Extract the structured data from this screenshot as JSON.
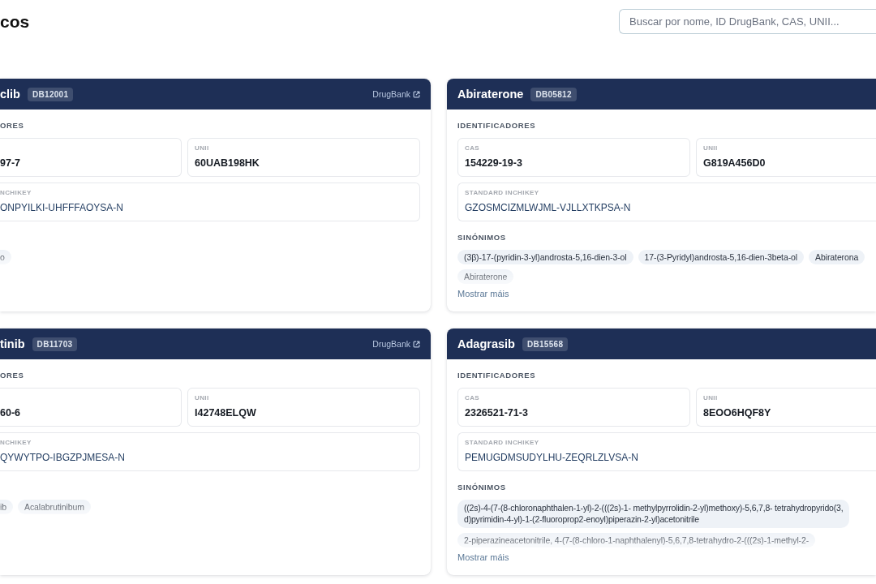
{
  "page": {
    "title": "cos"
  },
  "search": {
    "placeholder": "Buscar por nome, ID DrugBank, CAS, UNII..."
  },
  "cards": [
    {
      "name": "clib",
      "id": "DB12001",
      "link": "DrugBank",
      "identifiers_heading": "ORES",
      "fields": [
        {
          "kind": "id",
          "value": "97-7"
        },
        {
          "kind": "id",
          "label": "UNII",
          "value": "60UAB198HK"
        },
        {
          "kind": "inchikey",
          "label": "NCHIKEY",
          "value": "ONPYILKI-UHFFFAOYSA-N"
        }
      ],
      "synonyms": [
        "o"
      ]
    },
    {
      "name": "Abiraterone",
      "id": "DB05812",
      "identifiers_heading": "IDENTIFICADORES",
      "fields": [
        {
          "kind": "id",
          "label": "CAS",
          "value": "154229-19-3"
        },
        {
          "kind": "id",
          "label": "UNII",
          "value": "G819A456D0"
        },
        {
          "kind": "inchikey",
          "label": "STANDARD INCHIKEY",
          "value": "GZOSMCIZMLWJML-VJLLXTKPSA-N"
        }
      ],
      "synonyms_heading": "SINÓNIMOS",
      "synonyms": [
        "(3β)-17-(pyridin-3-yl)androsta-5,16-dien-3-ol",
        "17-(3-Pyridyl)androsta-5,16-dien-3beta-ol",
        "Abiraterona",
        "Abiraterone"
      ],
      "more": "Mostrar máis"
    },
    {
      "name": "tinib",
      "id": "DB11703",
      "link": "DrugBank",
      "identifiers_heading": "ORES",
      "fields": [
        {
          "kind": "id",
          "value": "60-6"
        },
        {
          "kind": "id",
          "label": "UNII",
          "value": "I42748ELQW"
        },
        {
          "kind": "inchikey",
          "label": "NCHIKEY",
          "value": "QYWYTPO-IBGZPJMESA-N"
        }
      ],
      "synonyms": [
        "ib",
        "Acalabrutinibum"
      ]
    },
    {
      "name": "Adagrasib",
      "id": "DB15568",
      "identifiers_heading": "IDENTIFICADORES",
      "fields": [
        {
          "kind": "id",
          "label": "CAS",
          "value": "2326521-71-3"
        },
        {
          "kind": "id",
          "label": "UNII",
          "value": "8EOO6HQF8Y"
        },
        {
          "kind": "inchikey",
          "label": "STANDARD INCHIKEY",
          "value": "PEMUGDMSUDYLHU-ZEQRLZLVSA-N"
        }
      ],
      "synonyms_heading": "SINÓNIMOS",
      "synonyms": [
        "((2s)-4-(7-(8-chloronaphthalen-1-yl)-2-(((2s)-1- methylpyrrolidin-2-yl)methoxy)-5,6,7,8- tetrahydropyrido(3,\nd)pyrimidin-4-yl)-1-(2-fluoroprop2-enoyl)piperazin-2-yl)acetonitrile",
        "2-piperazineacetonitrile, 4-(7-(8-chloro-1-naphthalenyl)-5,6,7,8-tetrahydro-2-(((2s)-1-methyl-2-"
      ],
      "more": "Mostrar máis"
    }
  ]
}
